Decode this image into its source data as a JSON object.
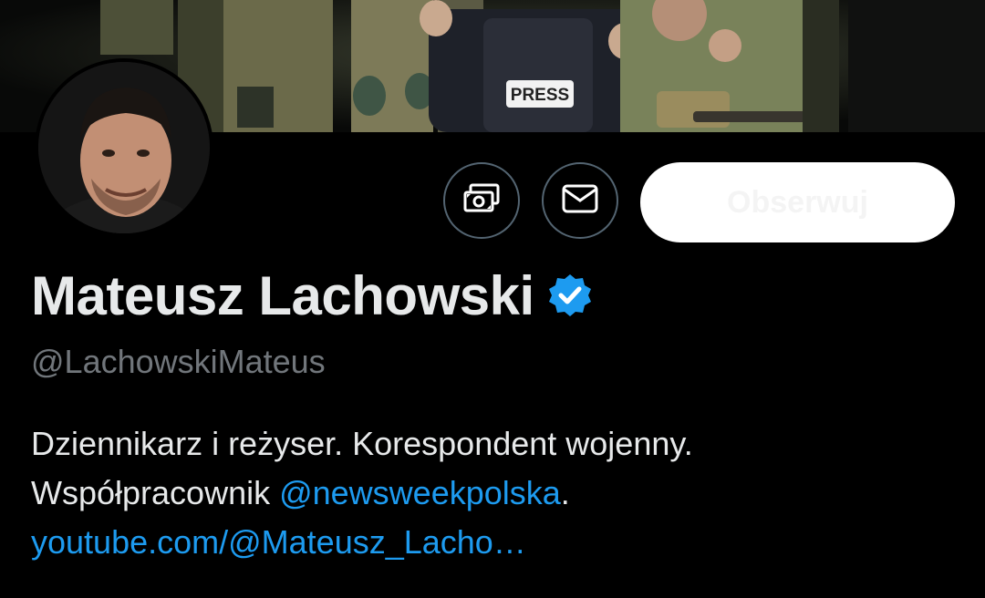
{
  "profile": {
    "display_name": "Mateusz Lachowski",
    "handle": "@LachowskiMateus",
    "verified": true,
    "verified_color": "#1d9bf0",
    "bio_line1": "Dziennikarz i reżyser. Korespondent wojenny.",
    "bio_line2_prefix": "Współpracownik ",
    "bio_mention": "@newsweekpolska",
    "bio_line2_suffix": ".",
    "bio_link": "youtube.com/@Mateusz_Lacho…",
    "banner_vest_text": "PRESS"
  },
  "actions": {
    "tip_icon": "money-icon",
    "message_icon": "envelope-icon",
    "follow_label": "Obserwuj"
  },
  "colors": {
    "background": "#000000",
    "text": "#e7e9ea",
    "muted": "#71767b",
    "accent": "#1d9bf0",
    "button_border": "#536471",
    "follow_bg": "#ffffff"
  }
}
